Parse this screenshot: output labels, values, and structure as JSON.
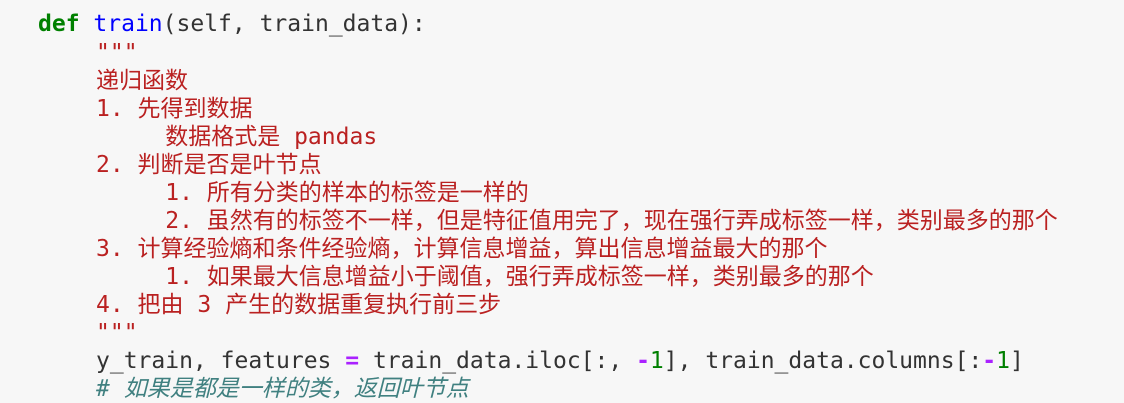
{
  "code": {
    "def_keyword": "def",
    "func_name": "train",
    "signature": "(self, train_data):",
    "docstring_open": "\"\"\"",
    "doc_lines": [
      "递归函数",
      "1. 先得到数据",
      "     数据格式是 pandas",
      "2. 判断是否是叶节点",
      "     1. 所有分类的样本的标签是一样的",
      "     2. 虽然有的标签不一样，但是特征值用完了，现在强行弄成标签一样，类别最多的那个",
      "3. 计算经验熵和条件经验熵，计算信息增益，算出信息增益最大的那个",
      "     1. 如果最大信息增益小于阈值，强行弄成标签一样，类别最多的那个",
      "4. 把由 3 产生的数据重复执行前三步"
    ],
    "docstring_close": "\"\"\"",
    "assign": {
      "lhs": "y_train, features ",
      "eq": "=",
      "part1": " train_data.iloc[:, ",
      "neg1": "-",
      "num1": "1",
      "part2": "], train_data.columns[:",
      "neg2": "-",
      "num2": "1",
      "part3": "]"
    },
    "comment": "# 如果是都是一样的类，返回叶节点"
  },
  "colors": {
    "background": "#f7f7f7",
    "keyword": "#008000",
    "function": "#0000ff",
    "string": "#ba2121",
    "number": "#008000",
    "operator": "#aa22ff",
    "comment": "#408080",
    "text": "#333333"
  }
}
